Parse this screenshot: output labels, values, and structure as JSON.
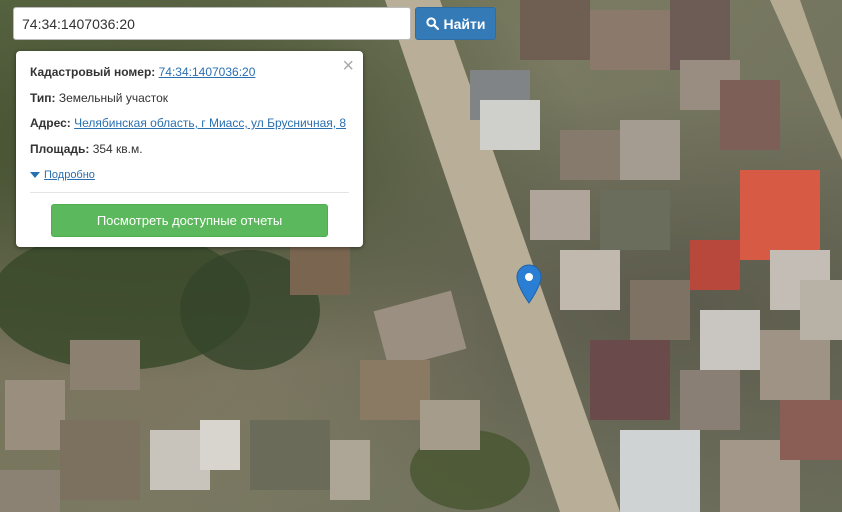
{
  "search": {
    "value": "74:34:1407036:20",
    "button_label": "Найти",
    "button_icon": "search-icon"
  },
  "popup": {
    "cadastral_label": "Кадастровый номер:",
    "cadastral_value": "74:34:1407036:20",
    "type_label": "Тип:",
    "type_value": "Земельный участок",
    "address_label": "Адрес:",
    "address_value": "Челябинская область, г Миасс, ул Брусничная, 8",
    "area_label": "Площадь:",
    "area_value": "354 кв.м.",
    "details_label": "Подробно",
    "reports_button": "Посмотреть доступные отчеты",
    "close_icon": "close-icon"
  },
  "map": {
    "marker_icon": "map-pin-icon",
    "colors": {
      "primary_button": "#337ab7",
      "success_button": "#5cb85c",
      "marker": "#2a7fd4"
    }
  }
}
